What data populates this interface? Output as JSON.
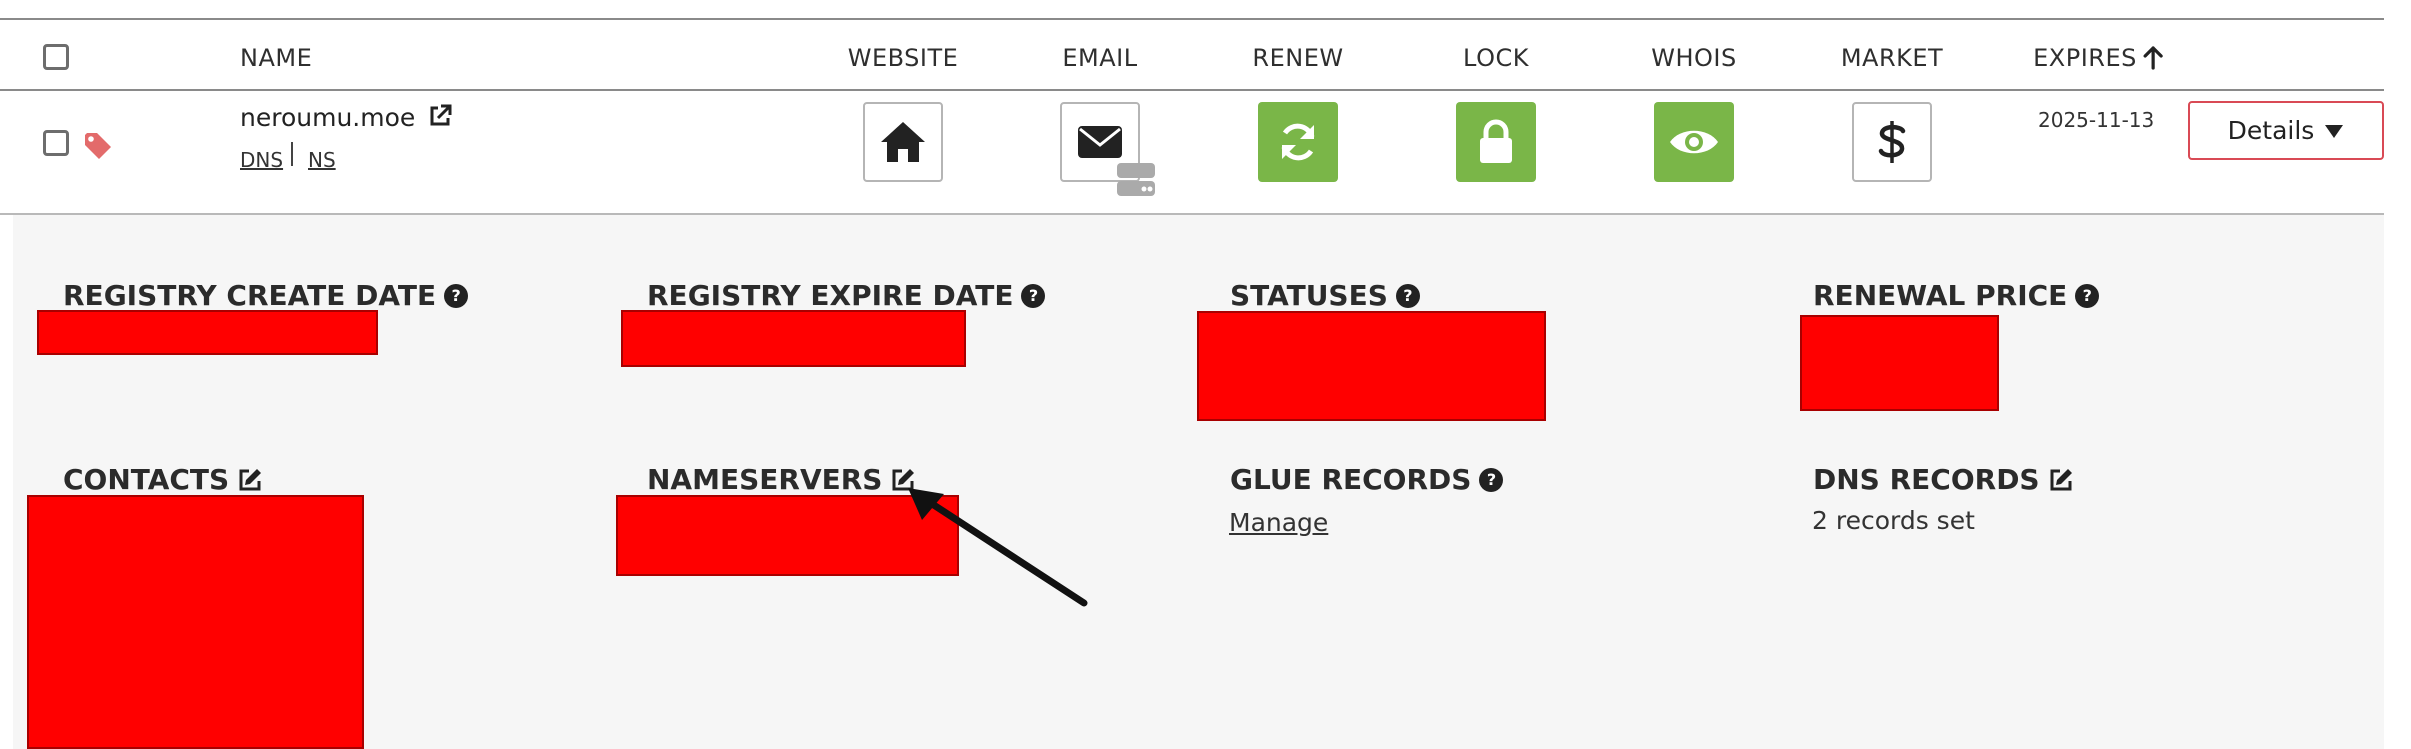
{
  "table": {
    "headers": {
      "name": "NAME",
      "website": "WEBSITE",
      "email": "EMAIL",
      "renew": "RENEW",
      "lock": "LOCK",
      "whois": "WHOIS",
      "market": "MARKET",
      "expires": "EXPIRES"
    },
    "sort_icon": "arrow-up-icon"
  },
  "row": {
    "domain": "neroumu.moe",
    "links": {
      "dns": "DNS",
      "ns": "NS"
    },
    "expires": "2025-11-13",
    "details_label": "Details",
    "details_icon": "caret-down-icon",
    "tag_color": "#e36b6b",
    "actions": [
      {
        "id": "website",
        "icon": "home-icon",
        "style": "outline"
      },
      {
        "id": "email",
        "icon": "envelope-icon",
        "style": "outline"
      },
      {
        "id": "renew",
        "icon": "refresh-icon",
        "style": "green"
      },
      {
        "id": "lock",
        "icon": "lock-icon",
        "style": "green"
      },
      {
        "id": "whois",
        "icon": "eye-icon",
        "style": "green"
      },
      {
        "id": "market",
        "icon": "dollar-icon",
        "style": "outline"
      }
    ]
  },
  "details": {
    "registry_create_date": {
      "label": "REGISTRY CREATE DATE"
    },
    "registry_expire_date": {
      "label": "REGISTRY EXPIRE DATE"
    },
    "statuses": {
      "label": "STATUSES"
    },
    "renewal_price": {
      "label": "RENEWAL PRICE"
    },
    "contacts": {
      "label": "CONTACTS"
    },
    "nameservers": {
      "label": "NAMESERVERS"
    },
    "glue_records": {
      "label": "GLUE RECORDS",
      "link": "Manage"
    },
    "dns_records": {
      "label": "DNS RECORDS",
      "value": "2 records set"
    }
  },
  "colors": {
    "green": "#7ab648",
    "details_border": "#d94a55",
    "redaction": "#ff0000",
    "panel_bg": "#f6f6f6"
  }
}
